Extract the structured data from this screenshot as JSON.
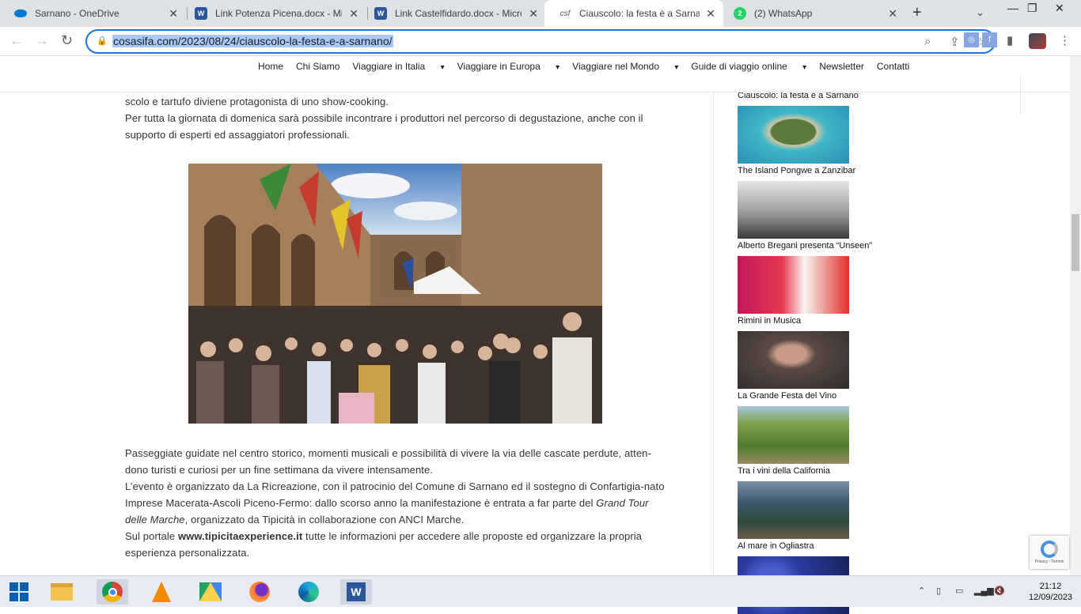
{
  "browser": {
    "tabs": [
      {
        "title": "Sarnano - OneDrive",
        "icon": "onedrive-icon"
      },
      {
        "title": "Link Potenza Picena.docx - Mic",
        "icon": "word-icon"
      },
      {
        "title": "Link Castelfidardo.docx - Micro",
        "icon": "word-icon"
      },
      {
        "title": "Ciauscolo: la festa è a Sarnano",
        "icon": "csf-icon",
        "fav": "csf"
      },
      {
        "title": "(2) WhatsApp",
        "icon": "whatsapp-icon",
        "badge": "2"
      }
    ],
    "url": "cosasifa.com/2023/08/24/ciauscolo-la-festa-e-a-sarnano/"
  },
  "site": {
    "menu": [
      "Home",
      "Chi Siamo",
      "Viaggiare in Italia",
      "Viaggiare in Europa",
      "Viaggiare nel Mondo",
      "Guide di viaggio online",
      "Newsletter",
      "Contatti"
    ],
    "dropdown_marker": "▾"
  },
  "article": {
    "p1": "scolo e tartufo diviene protagonista di uno show-cooking.",
    "p2": "Per tutta la giornata di domenica sarà possibile incontrare i produttori nel percorso di degustazione, anche con il supporto di esperti ed assaggiatori professionali.",
    "p3": "Passeggiate guidate nel centro storico, momenti musicali e possibilità di vivere la via delle cascate perdute, atten-dono turisti e curiosi per un fine settimana da vivere intensamente.",
    "p4a": "L’evento è organizzato da La Ricreazione, con il patrocinio del Comune di Sarnano ed il sostegno di Confartigia-nato Imprese Macerata-Ascoli Piceno-Fermo: dallo scorso anno la manifestazione è entrata a far parte del ",
    "p4em": "Grand Tour delle Marche",
    "p4b": ", organizzato da Tipicità in collaborazione con ANCI Marche.",
    "p5a": "Sul portale ",
    "p5link": "www.tipicitaexperience.it",
    "p5b": "  tutte le informazioni per accedere alle proposte ed organizzare la propria esperienza personalizzata."
  },
  "sidebar": {
    "items": [
      {
        "caption": "Ciauscolo: la festa è a Sarnano"
      },
      {
        "caption": "The Island Pongwe a Zanzibar"
      },
      {
        "caption": "Alberto Bregani presenta “Unseen”"
      },
      {
        "caption": "Rimini in Musica"
      },
      {
        "caption": "La Grande Festa del Vino"
      },
      {
        "caption": "Tra i vini della California"
      },
      {
        "caption": "Al mare in Ogliastra"
      }
    ]
  },
  "recaptcha": {
    "text": "Privacy - Termini"
  },
  "taskbar": {
    "time": "21:12",
    "date": "12/09/2023"
  }
}
